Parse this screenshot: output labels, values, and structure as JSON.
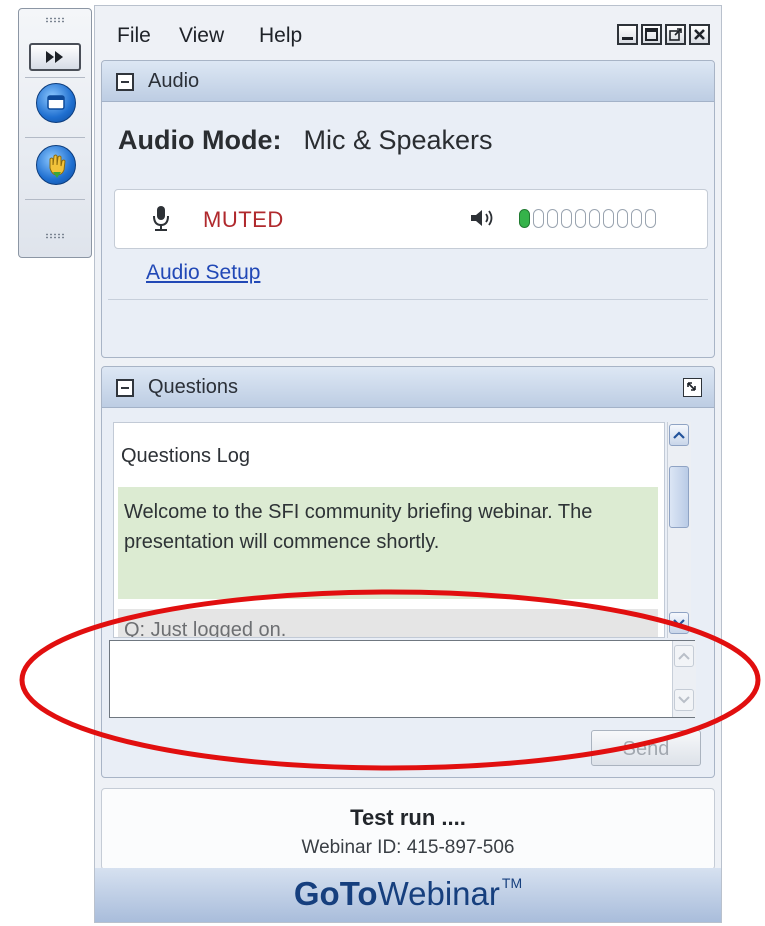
{
  "menu": {
    "file": "File",
    "view": "View",
    "help": "Help"
  },
  "window_controls": {
    "minimize": "minimize-icon",
    "restore": "restore-icon",
    "popout": "popout-icon",
    "close": "close-icon"
  },
  "audio": {
    "title": "Audio",
    "mode_label": "Audio Mode:",
    "mode_value": "Mic & Speakers",
    "mic_status": "MUTED",
    "speaker_level": {
      "lit": 1,
      "total": 10
    },
    "setup_link": "Audio Setup"
  },
  "questions": {
    "title": "Questions",
    "log_title": "Questions Log",
    "messages": [
      "Welcome to the SFI community briefing webinar. The presentation will commence shortly.",
      "Q: Just logged on."
    ],
    "input_value": "",
    "send_label": "Send"
  },
  "footer": {
    "title": "Test run ....",
    "webinar_id": "Webinar ID: 415-897-506"
  },
  "brand": {
    "part1": "GoTo",
    "part2": "Webinar",
    "tm": "TM"
  },
  "colors": {
    "muted": "#b0292d",
    "link": "#2148b6",
    "message_bg": "#dcebd2",
    "highlight_ring": "#e10f0f",
    "brand": "#163f7e"
  }
}
